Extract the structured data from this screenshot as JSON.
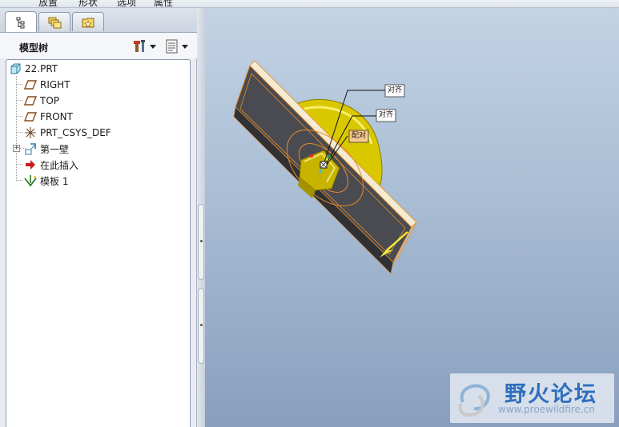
{
  "menubar": {
    "items": [
      "放置",
      "形状",
      "选项",
      "属性"
    ]
  },
  "tabs": [
    {
      "icon": "model-tree-tab-icon"
    },
    {
      "icon": "layers-folder-tab-icon"
    },
    {
      "icon": "favorites-folder-tab-icon"
    }
  ],
  "tree_panel": {
    "title": "模型树",
    "settings_icon": "tools-icon",
    "display_icon": "list-settings-icon"
  },
  "tree": {
    "root": "22.PRT",
    "items": [
      {
        "label": "RIGHT",
        "icon": "datum-plane-icon"
      },
      {
        "label": "TOP",
        "icon": "datum-plane-icon"
      },
      {
        "label": "FRONT",
        "icon": "datum-plane-icon"
      },
      {
        "label": "PRT_CSYS_DEF",
        "icon": "coordinate-system-icon"
      },
      {
        "label": "第一壁",
        "icon": "sheetmetal-wall-icon"
      },
      {
        "label": "在此插入",
        "icon": "insert-here-arrow-icon"
      },
      {
        "label": "模板 1",
        "icon": "form-feature-icon"
      }
    ]
  },
  "viewport": {
    "annotations": [
      "对齐",
      "对齐",
      "配对"
    ],
    "colors": {
      "part_dark": "#494b50",
      "part_edge": "#e88a2a",
      "punch_yellow": "#d9c800",
      "accent_arrow": "#f0ea3a"
    }
  },
  "watermark": {
    "title": "野火论坛",
    "url": "www.proewildfire.cn"
  }
}
